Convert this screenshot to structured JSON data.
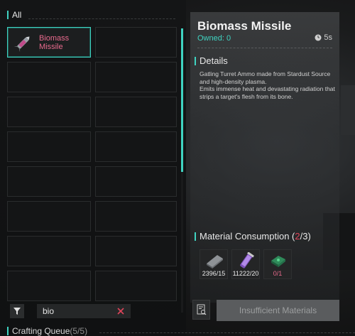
{
  "inventory": {
    "tab_label": "All",
    "selected_item": {
      "name_line1": "Biomass",
      "name_line2": "Missile"
    },
    "empty_slot_count": 15
  },
  "search": {
    "value": "bio"
  },
  "queue": {
    "label": "Crafting Queue",
    "count": "(5/5)"
  },
  "detail": {
    "title": "Biomass Missile",
    "owned_label": "Owned:",
    "owned_value": "0",
    "time": "5s",
    "details_header": "Details",
    "details_line1": "Gatling Turret Ammo made from Stardust Source and high-density plasma.",
    "details_line2": "Emits immense heat and devastating radiation that strips a target's flesh from its bone.",
    "materials_header": "Material Consumption (",
    "materials_have": "2",
    "materials_sep": "/3)",
    "materials": [
      {
        "icon": "steel-plate-icon",
        "qty": "2396/15",
        "sufficient": true
      },
      {
        "icon": "plasma-vial-icon",
        "qty": "11222/20",
        "sufficient": true
      },
      {
        "icon": "green-cartridge-icon",
        "qty": "0/1",
        "sufficient": false
      }
    ],
    "craft_button": "Insufficient Materials"
  },
  "colors": {
    "accent": "#3fd3c1",
    "item_name": "#e86a8d",
    "warning": "#e0455a"
  }
}
